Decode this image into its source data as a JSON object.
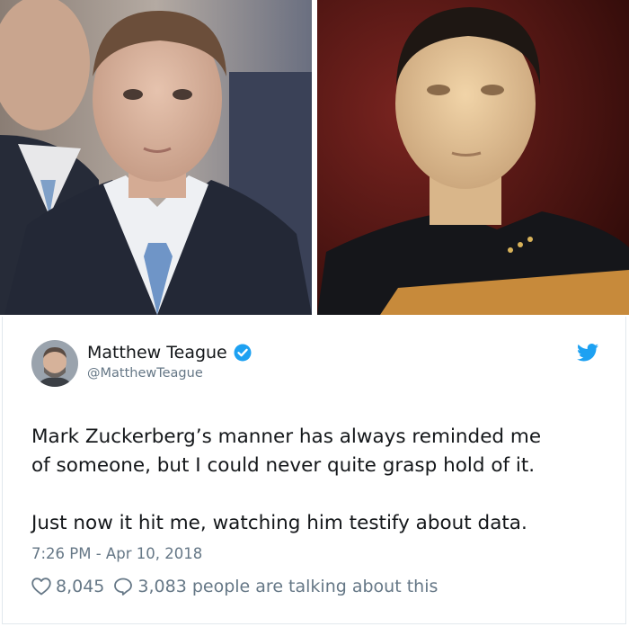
{
  "author": {
    "name": "Matthew Teague",
    "handle": "@MatthewTeague",
    "verified": true
  },
  "tweet": {
    "lines": [
      "Mark Zuckerberg’s manner has always reminded me",
      "of someone, but I could never quite grasp hold of it.",
      "Just now it hit me, watching him testify about data."
    ],
    "timestamp": "7:26 PM - Apr 10, 2018",
    "likes": "8,045",
    "replies_text": "3,083 people are talking about this"
  },
  "images": [
    {
      "icon": "photo-man-in-suit"
    },
    {
      "icon": "photo-android-character"
    }
  ],
  "colors": {
    "brand": "#1da1f2",
    "text": "#14171a",
    "muted": "#657786",
    "border": "#e1e8ed"
  }
}
